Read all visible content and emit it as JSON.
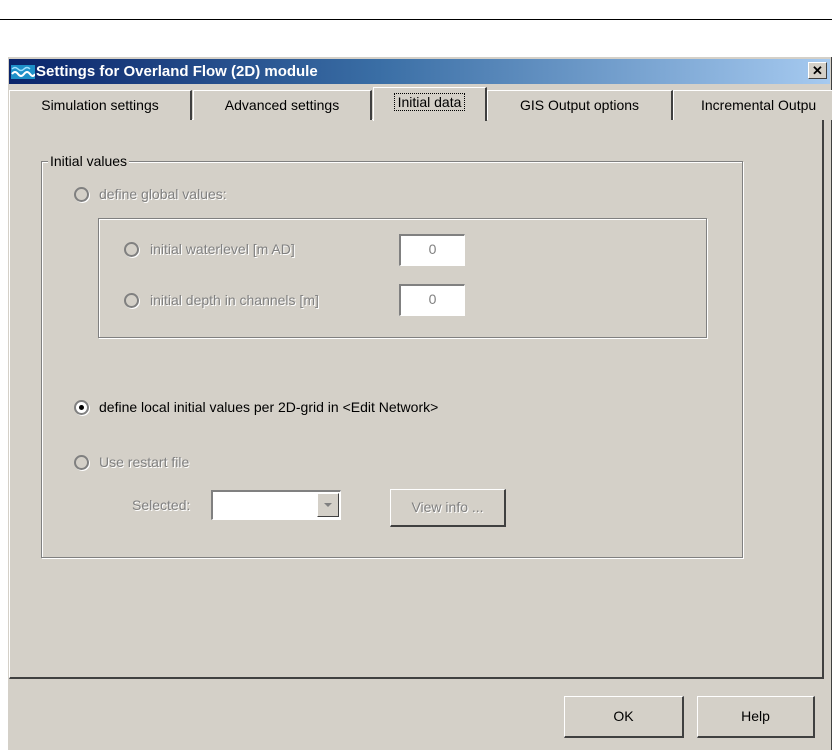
{
  "window": {
    "title": "Settings for Overland Flow (2D) module",
    "close_glyph": "✕",
    "icon": "overland-flow-icon"
  },
  "tabs": [
    {
      "label": "Simulation settings",
      "mnemonic": "S"
    },
    {
      "label": "Advanced settings",
      "mnemonic": "A"
    },
    {
      "label": "Initial data",
      "mnemonic": "I",
      "active": true
    },
    {
      "label": "GIS Output options",
      "mnemonic": "G"
    },
    {
      "label": "Incremental Outpu",
      "mnemonic": "I"
    }
  ],
  "initial_values": {
    "group_label": "Initial values",
    "global_option": {
      "label": "define global values:",
      "selected": false,
      "enabled": false
    },
    "water_level": {
      "label": "initial waterlevel [m AD]",
      "value": "0",
      "enabled": false
    },
    "channel_depth": {
      "label": "initial depth in channels [m]",
      "value": "0",
      "enabled": false
    },
    "local_option": {
      "label": "define local initial values per 2D-grid in <Edit Network>",
      "selected": true,
      "enabled": true
    },
    "restart_option": {
      "label": "Use restart file",
      "selected": false,
      "enabled": false
    },
    "selected_label": "Selected:",
    "selected_value": "",
    "view_info_label": "View info ..."
  },
  "footer": {
    "ok_label": "OK",
    "help_label": "Help"
  },
  "colors": {
    "dialog_bg": "#d4d0c8",
    "titlebar_start": "#0a246a",
    "titlebar_end": "#a6caf0",
    "disabled_text": "#808080"
  }
}
